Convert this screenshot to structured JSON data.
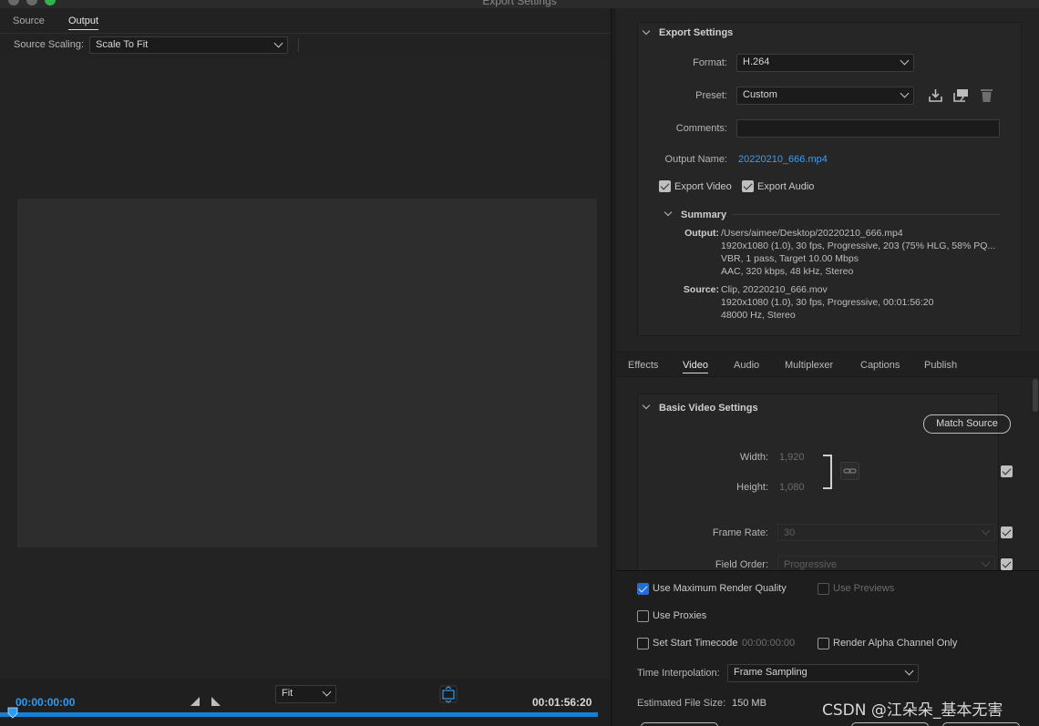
{
  "window": {
    "title": "Export Settings"
  },
  "left": {
    "tabs": [
      {
        "label": "Source",
        "active": false
      },
      {
        "label": "Output",
        "active": true
      }
    ],
    "source_scaling_label": "Source Scaling:",
    "source_scaling_value": "Scale To Fit",
    "timecode_in": "00:00:00:00",
    "zoom_value": "Fit",
    "timecode_duration": "00:01:56:20"
  },
  "export_settings": {
    "title": "Export Settings",
    "format_label": "Format:",
    "format_value": "H.264",
    "preset_label": "Preset:",
    "preset_value": "Custom",
    "comments_label": "Comments:",
    "comments_value": "",
    "output_name_label": "Output Name:",
    "output_name_value": "20220210_666.mp4",
    "export_video_label": "Export Video",
    "export_video_checked": true,
    "export_audio_label": "Export Audio",
    "export_audio_checked": true
  },
  "summary": {
    "title": "Summary",
    "output_label": "Output:",
    "output_lines": [
      "/Users/aimee/Desktop/20220210_666.mp4",
      "1920x1080 (1.0), 30 fps, Progressive, 203 (75% HLG, 58% PQ...",
      "VBR, 1 pass, Target 10.00 Mbps",
      "AAC, 320 kbps, 48 kHz, Stereo"
    ],
    "source_label": "Source:",
    "source_lines": [
      "Clip, 20220210_666.mov",
      "1920x1080 (1.0), 30 fps, Progressive, 00:01:56:20",
      "48000 Hz, Stereo"
    ]
  },
  "settings_tabs": [
    {
      "label": "Effects",
      "active": false
    },
    {
      "label": "Video",
      "active": true
    },
    {
      "label": "Audio",
      "active": false
    },
    {
      "label": "Multiplexer",
      "active": false
    },
    {
      "label": "Captions",
      "active": false
    },
    {
      "label": "Publish",
      "active": false
    }
  ],
  "basic_video": {
    "title": "Basic Video Settings",
    "match_source_label": "Match Source",
    "width_label": "Width:",
    "width_value": "1,920",
    "height_label": "Height:",
    "height_value": "1,080",
    "frame_rate_label": "Frame Rate:",
    "frame_rate_value": "30",
    "field_order_label": "Field Order:",
    "field_order_value": "Progressive"
  },
  "bottom_options": {
    "max_render_quality_label": "Use Maximum Render Quality",
    "max_render_quality_checked": true,
    "use_previews_label": "Use Previews",
    "use_proxies_label": "Use Proxies",
    "set_start_timecode_label": "Set Start Timecode",
    "start_timecode_value": "00:00:00:00",
    "render_alpha_label": "Render Alpha Channel Only",
    "time_interpolation_label": "Time Interpolation:",
    "time_interpolation_value": "Frame Sampling",
    "estimated_size_label": "Estimated File Size:",
    "estimated_size_value": "150 MB"
  },
  "watermark": "CSDN @江朵朵_基本无害",
  "colors": {
    "accent": "#1f6fd6",
    "link": "#3f9cf0",
    "timeline": "#1a7fcf"
  }
}
